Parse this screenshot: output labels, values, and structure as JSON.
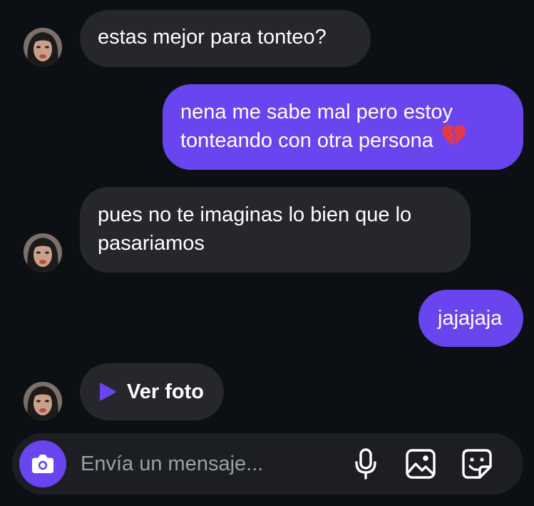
{
  "messages": [
    {
      "direction": "incoming",
      "lines": [
        "estas mejor para tonteo?"
      ]
    },
    {
      "direction": "outgoing",
      "lines": [
        "nena me sabe mal pero estoy",
        "tonteando con otra persona"
      ],
      "trailing_icon": "broken-heart-icon"
    },
    {
      "direction": "incoming",
      "lines": [
        "pues no te imaginas lo bien que lo",
        "pasariamos"
      ]
    },
    {
      "direction": "outgoing",
      "lines": [
        "jajajaja"
      ]
    },
    {
      "direction": "incoming",
      "type": "photo",
      "label": "Ver foto",
      "icon": "play-icon"
    }
  ],
  "composer": {
    "placeholder": "Envía un mensaje...",
    "value": "",
    "left_button_icon": "camera-icon",
    "tools": [
      "microphone-icon",
      "gallery-icon",
      "sticker-icon"
    ]
  },
  "colors": {
    "background": "#0c0f14",
    "incoming_bubble": "#25272c",
    "outgoing_bubble": "#6a45ef",
    "accent": "#6a45ef",
    "composer": "#1c1e22"
  }
}
